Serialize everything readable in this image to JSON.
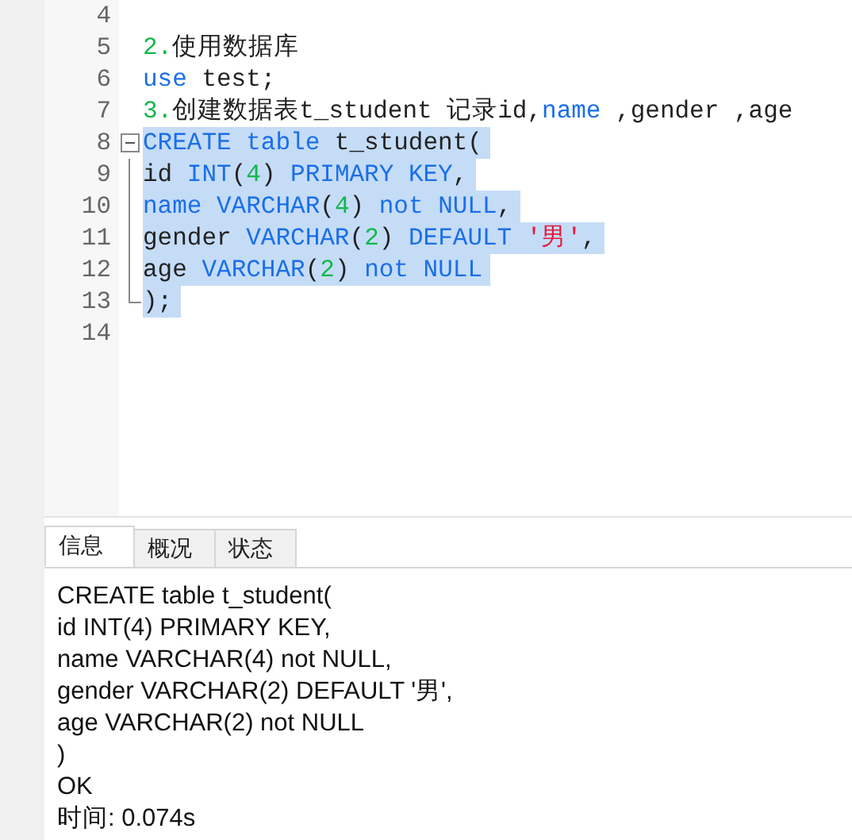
{
  "editor": {
    "lines": [
      {
        "number": "4",
        "kind": "plain"
      },
      {
        "number": "5",
        "selected": false,
        "kind": "plain",
        "tokens": [
          {
            "text": "2.",
            "kind": "number"
          },
          {
            "text": "使用数据库",
            "kind": "plain"
          }
        ]
      },
      {
        "number": "6",
        "selected": false,
        "kind": "plain",
        "tokens": [
          {
            "text": "use",
            "kind": "keyword"
          },
          {
            "text": " test;",
            "kind": "plain"
          }
        ]
      },
      {
        "number": "7",
        "selected": false,
        "kind": "plain",
        "tokens": [
          {
            "text": "3.",
            "kind": "number"
          },
          {
            "text": "创建数据表t_student 记录id,",
            "kind": "plain"
          },
          {
            "text": "name",
            "kind": "keyword"
          },
          {
            "text": " ,gender ,age",
            "kind": "plain"
          }
        ]
      },
      {
        "number": "8",
        "selected": true,
        "kind": "foldstart",
        "tokens": [
          {
            "text": "CREATE table",
            "kind": "keyword"
          },
          {
            "text": " t_student(",
            "kind": "plain"
          }
        ]
      },
      {
        "number": "9",
        "selected": true,
        "kind": "foldbody",
        "tokens": [
          {
            "text": "id ",
            "kind": "plain"
          },
          {
            "text": "INT",
            "kind": "keyword"
          },
          {
            "text": "(",
            "kind": "plain"
          },
          {
            "text": "4",
            "kind": "number"
          },
          {
            "text": ") ",
            "kind": "plain"
          },
          {
            "text": "PRIMARY KEY",
            "kind": "keyword"
          },
          {
            "text": ",",
            "kind": "plain"
          }
        ]
      },
      {
        "number": "10",
        "selected": true,
        "kind": "foldbody",
        "tokens": [
          {
            "text": "name VARCHAR",
            "kind": "keyword"
          },
          {
            "text": "(",
            "kind": "plain"
          },
          {
            "text": "4",
            "kind": "number"
          },
          {
            "text": ") ",
            "kind": "plain"
          },
          {
            "text": "not NULL",
            "kind": "keyword"
          },
          {
            "text": ",",
            "kind": "plain"
          }
        ]
      },
      {
        "number": "11",
        "selected": true,
        "kind": "foldbody",
        "tokens": [
          {
            "text": "gender ",
            "kind": "plain"
          },
          {
            "text": "VARCHAR",
            "kind": "keyword"
          },
          {
            "text": "(",
            "kind": "plain"
          },
          {
            "text": "2",
            "kind": "number"
          },
          {
            "text": ") ",
            "kind": "plain"
          },
          {
            "text": "DEFAULT ",
            "kind": "keyword"
          },
          {
            "text": "'男'",
            "kind": "string"
          },
          {
            "text": ",",
            "kind": "plain"
          }
        ]
      },
      {
        "number": "12",
        "selected": true,
        "kind": "foldbody",
        "tokens": [
          {
            "text": "age ",
            "kind": "plain"
          },
          {
            "text": "VARCHAR",
            "kind": "keyword"
          },
          {
            "text": "(",
            "kind": "plain"
          },
          {
            "text": "2",
            "kind": "number"
          },
          {
            "text": ") ",
            "kind": "plain"
          },
          {
            "text": "not NULL",
            "kind": "keyword"
          }
        ]
      },
      {
        "number": "13",
        "selected": true,
        "kind": "foldend",
        "tokens": [
          {
            "text": ");",
            "kind": "plain"
          }
        ]
      },
      {
        "number": "14",
        "kind": "plain"
      }
    ]
  },
  "tabs": [
    {
      "label": "信息",
      "selected": true
    },
    {
      "label": "概况",
      "selected": false
    },
    {
      "label": "状态",
      "selected": false
    }
  ],
  "output": [
    "CREATE table t_student(",
    "id INT(4) PRIMARY KEY,",
    "name VARCHAR(4) not NULL,",
    "gender VARCHAR(2) DEFAULT '男',",
    "age VARCHAR(2) not NULL",
    ")",
    "OK",
    "时间: 0.074s"
  ]
}
